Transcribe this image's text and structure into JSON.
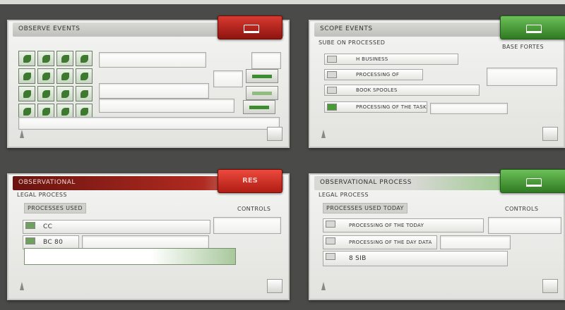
{
  "panel_top_left": {
    "title": "OBSERVE EVENTS",
    "action_button": {
      "color": "#b12218"
    },
    "thumbnails": [
      1,
      2,
      3,
      4,
      5,
      6,
      7,
      8,
      9,
      10,
      11,
      12,
      13,
      14,
      15,
      16
    ],
    "corner_icon": "shell-icon",
    "footer_icon": "window-icon"
  },
  "panel_top_right": {
    "title": "SCOPE EVENTS",
    "subtitle": "SUBE ON PROCESSED",
    "action_button": {
      "color": "#4a9a38"
    },
    "side_label": "BASE FORTES",
    "rows": [
      {
        "label": "H BUSINESS"
      },
      {
        "label": "PROCESSING OF"
      },
      {
        "label": "BOOK SPOOLES"
      },
      {
        "label": "PROCESSING OF THE TASK"
      }
    ],
    "corner_icon": "shell-icon",
    "footer_icon": "window-icon"
  },
  "panel_bottom_left": {
    "title": "OBSERVATIONAL",
    "subtitle": "LEGAL PROCESS",
    "action_button": {
      "color": "#d8362c",
      "label": "RES"
    },
    "section_label": "PROCESSES USED",
    "right_label": "CONTROLS",
    "rows": [
      {
        "label": "CC"
      },
      {
        "label": "BC 80"
      }
    ],
    "corner_icon": "shell-icon",
    "footer_icon": "window-icon"
  },
  "panel_bottom_right": {
    "title": "OBSERVATIONAL PROCESS",
    "subtitle": "LEGAL PROCESS",
    "action_button": {
      "color": "#3e8e2e"
    },
    "section_label": "PROCESSES USED TODAY",
    "right_label": "CONTROLS",
    "rows": [
      {
        "label": "PROCESSING OF THE TODAY"
      },
      {
        "label": "PROCESSING OF THE DAY DATA"
      },
      {
        "label": "8 SIB"
      }
    ],
    "corner_icon": "shell-icon",
    "footer_icon": "window-icon"
  }
}
